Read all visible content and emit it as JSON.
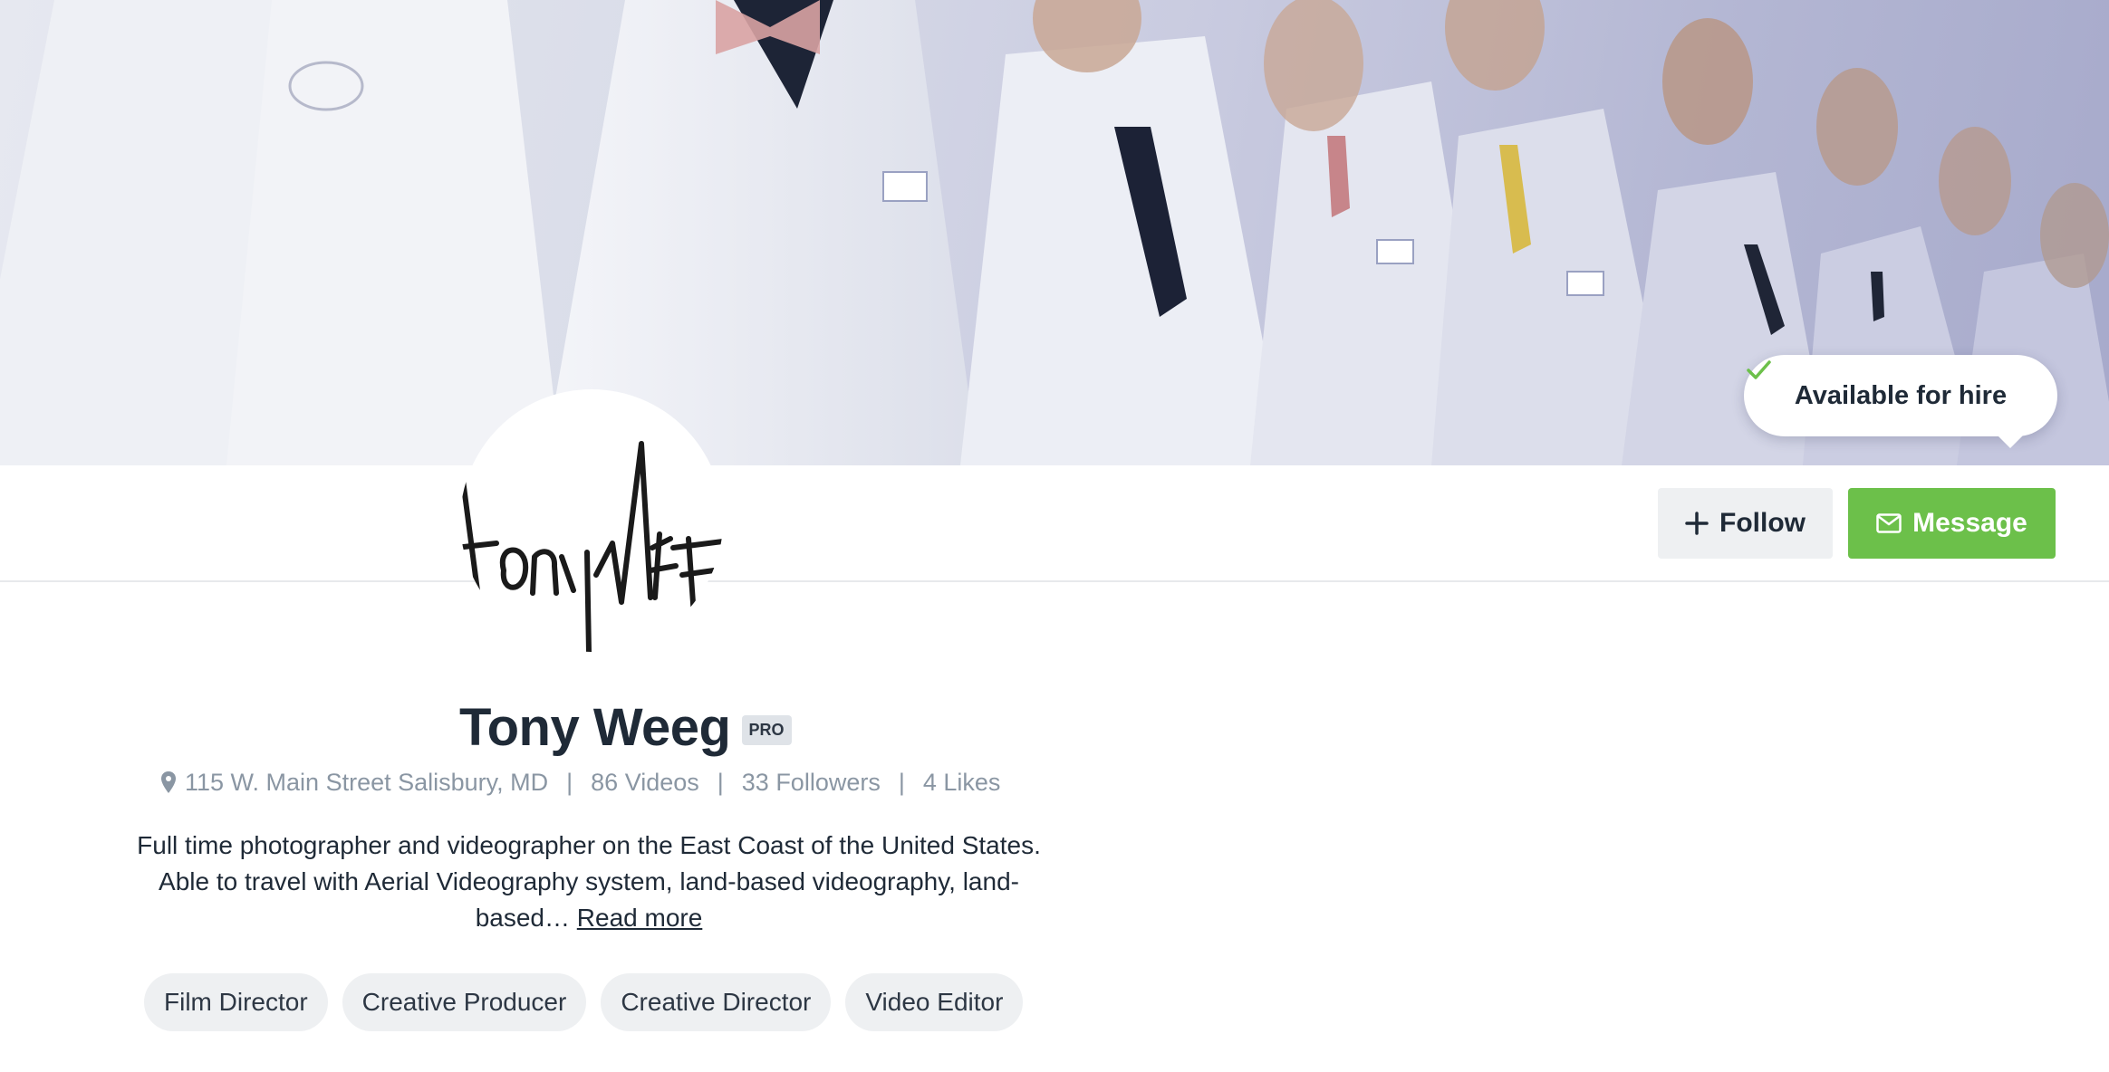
{
  "cover": {
    "hire_label": "Available for hire"
  },
  "actions": {
    "follow_label": "Follow",
    "message_label": "Message"
  },
  "profile": {
    "name": "Tony Weeg",
    "badge": "PRO",
    "location": "115 W. Main Street Salisbury, MD",
    "separator": "|",
    "videos": "86 Videos",
    "followers": "33 Followers",
    "likes": "4 Likes",
    "bio": "Full time photographer and videographer on the East Coast of the United States. Able to travel with Aerial Videography system, land-based videography, land-based…",
    "read_more": "Read more",
    "tags": [
      "Film Director",
      "Creative Producer",
      "Creative Director",
      "Video Editor"
    ]
  },
  "colors": {
    "accent_green": "#6cc04a",
    "text_dark": "#1f2a37",
    "text_muted": "#8a96a3",
    "chip_bg": "#eef0f2"
  },
  "icons": {
    "hire": "check-icon",
    "follow": "plus-icon",
    "message": "envelope-icon",
    "location": "map-pin-icon"
  }
}
